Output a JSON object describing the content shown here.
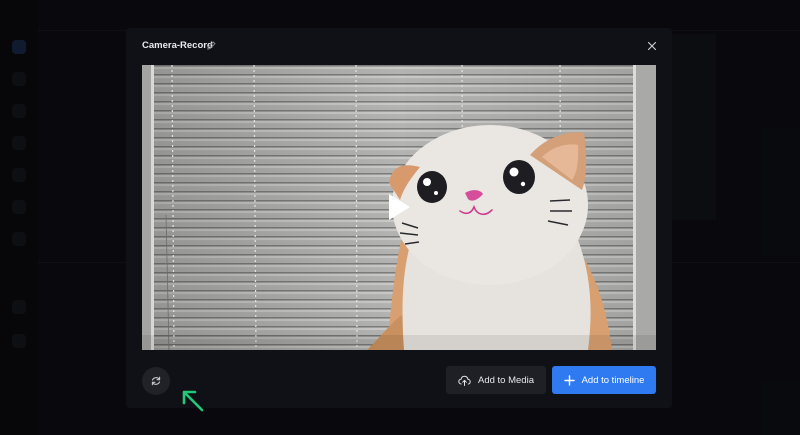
{
  "modal": {
    "title": "Camera-Record"
  },
  "actions": {
    "add_to_media": "Add to Media",
    "add_to_timeline": "Add to timeline"
  },
  "icons": {
    "edit": "pencil-icon",
    "close": "close-icon",
    "play": "play-icon",
    "refresh": "refresh-icon",
    "upload": "cloud-upload-icon",
    "plus": "plus-icon",
    "annotation": "arrow-up-left-icon"
  },
  "colors": {
    "accent": "#2f7af1",
    "annotation": "#22c97a"
  }
}
